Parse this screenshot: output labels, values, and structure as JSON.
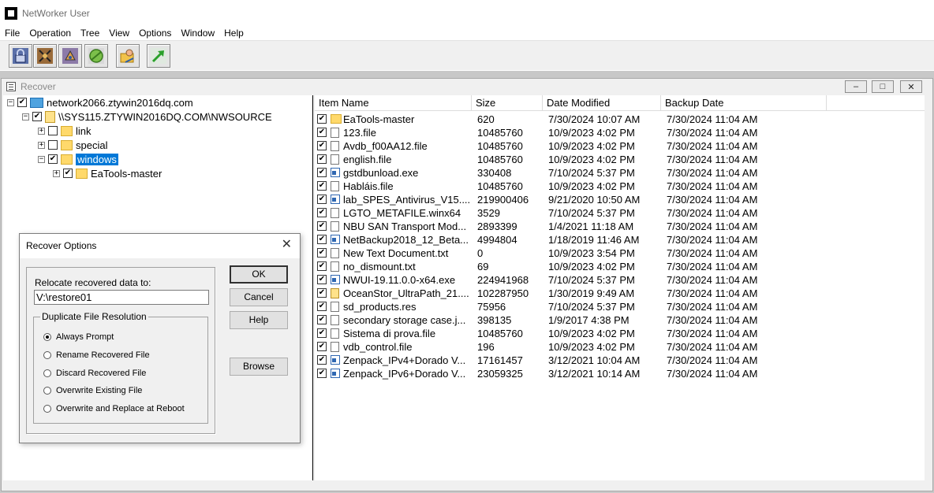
{
  "app": {
    "title": "NetWorker User"
  },
  "menu": [
    "File",
    "Operation",
    "Tree",
    "View",
    "Options",
    "Window",
    "Help"
  ],
  "toolbar": {
    "buttons": [
      "lock-icon",
      "scissors-icon",
      "recover-icon",
      "globe-icon",
      "user-folder-icon",
      "arrow-up-icon"
    ]
  },
  "recover_window": {
    "title": "Recover",
    "controls": [
      "–",
      "□",
      "✕"
    ]
  },
  "tree": {
    "items": [
      {
        "label": "network2066.ztywin2016dq.com",
        "expander": "−",
        "checked": true,
        "icon": "computer-icon"
      },
      {
        "label": "\\\\SYS115.ZTYWIN2016DQ.COM\\NWSOURCE",
        "expander": "−",
        "checked": true,
        "icon": "share-icon"
      },
      {
        "label": "link",
        "expander": "+",
        "checked": false,
        "icon": "folder-icon"
      },
      {
        "label": "special",
        "expander": "+",
        "checked": false,
        "icon": "folder-icon"
      },
      {
        "label": "windows",
        "expander": "−",
        "checked": true,
        "icon": "folder-icon",
        "selected": true
      },
      {
        "label": "EaTools-master",
        "expander": "+",
        "checked": true,
        "icon": "folder-icon"
      }
    ]
  },
  "file_list": {
    "columns": [
      "Item Name",
      "Size",
      "Date Modified",
      "Backup Date"
    ],
    "rows": [
      {
        "name": "EaTools-master",
        "size": "620",
        "modified": "7/30/2024 10:07 AM",
        "backup": "7/30/2024 11:04 AM",
        "icon": "folder"
      },
      {
        "name": "123.file",
        "size": "10485760",
        "modified": "10/9/2023 4:02 PM",
        "backup": "7/30/2024 11:04 AM",
        "icon": "file"
      },
      {
        "name": "Avdb_f00AA12.file",
        "size": "10485760",
        "modified": "10/9/2023 4:02 PM",
        "backup": "7/30/2024 11:04 AM",
        "icon": "file"
      },
      {
        "name": "english.file",
        "size": "10485760",
        "modified": "10/9/2023 4:02 PM",
        "backup": "7/30/2024 11:04 AM",
        "icon": "file"
      },
      {
        "name": "gstdbunload.exe",
        "size": "330408",
        "modified": "7/10/2024 5:37 PM",
        "backup": "7/30/2024 11:04 AM",
        "icon": "exe"
      },
      {
        "name": "Habláis.file",
        "size": "10485760",
        "modified": "10/9/2023 4:02 PM",
        "backup": "7/30/2024 11:04 AM",
        "icon": "file"
      },
      {
        "name": "lab_SPES_Antivirus_V15....",
        "size": "219900406",
        "modified": "9/21/2020 10:50 AM",
        "backup": "7/30/2024 11:04 AM",
        "icon": "exe"
      },
      {
        "name": "LGTO_METAFILE.winx64",
        "size": "3529",
        "modified": "7/10/2024 5:37 PM",
        "backup": "7/30/2024 11:04 AM",
        "icon": "file"
      },
      {
        "name": "NBU SAN Transport Mod...",
        "size": "2893399",
        "modified": "1/4/2021 11:18 AM",
        "backup": "7/30/2024 11:04 AM",
        "icon": "file"
      },
      {
        "name": "NetBackup2018_12_Beta...",
        "size": "4994804",
        "modified": "1/18/2019 11:46 AM",
        "backup": "7/30/2024 11:04 AM",
        "icon": "exe"
      },
      {
        "name": "New Text Document.txt",
        "size": "0",
        "modified": "10/9/2023 3:54 PM",
        "backup": "7/30/2024 11:04 AM",
        "icon": "file"
      },
      {
        "name": "no_dismount.txt",
        "size": "69",
        "modified": "10/9/2023 4:02 PM",
        "backup": "7/30/2024 11:04 AM",
        "icon": "file"
      },
      {
        "name": "NWUI-19.11.0.0-x64.exe",
        "size": "224941968",
        "modified": "7/10/2024 5:37 PM",
        "backup": "7/30/2024 11:04 AM",
        "icon": "exe"
      },
      {
        "name": "OceanStor_UltraPath_21....",
        "size": "102287950",
        "modified": "1/30/2019 9:49 AM",
        "backup": "7/30/2024 11:04 AM",
        "icon": "zip"
      },
      {
        "name": "sd_products.res",
        "size": "75956",
        "modified": "7/10/2024 5:37 PM",
        "backup": "7/30/2024 11:04 AM",
        "icon": "file"
      },
      {
        "name": "secondary storage case.j...",
        "size": "398135",
        "modified": "1/9/2017 4:38 PM",
        "backup": "7/30/2024 11:04 AM",
        "icon": "file"
      },
      {
        "name": "Sistema di prova.file",
        "size": "10485760",
        "modified": "10/9/2023 4:02 PM",
        "backup": "7/30/2024 11:04 AM",
        "icon": "file"
      },
      {
        "name": "vdb_control.file",
        "size": "196",
        "modified": "10/9/2023 4:02 PM",
        "backup": "7/30/2024 11:04 AM",
        "icon": "file"
      },
      {
        "name": "Zenpack_IPv4+Dorado V...",
        "size": "17161457",
        "modified": "3/12/2021 10:04 AM",
        "backup": "7/30/2024 11:04 AM",
        "icon": "exe"
      },
      {
        "name": "Zenpack_IPv6+Dorado V...",
        "size": "23059325",
        "modified": "3/12/2021 10:14 AM",
        "backup": "7/30/2024 11:04 AM",
        "icon": "exe"
      }
    ]
  },
  "dialog": {
    "title": "Recover Options",
    "close": "✕",
    "relocate_label": "Relocate recovered data to:",
    "relocate_value": "V:\\restore01",
    "duplicate_legend": "Duplicate File Resolution",
    "options": [
      {
        "label": "Always Prompt",
        "selected": true
      },
      {
        "label": "Rename Recovered File",
        "selected": false
      },
      {
        "label": "Discard Recovered File",
        "selected": false
      },
      {
        "label": "Overwrite Existing File",
        "selected": false
      },
      {
        "label": "Overwrite and Replace at Reboot",
        "selected": false
      }
    ],
    "buttons": {
      "ok": "OK",
      "cancel": "Cancel",
      "help": "Help",
      "browse": "Browse"
    }
  }
}
